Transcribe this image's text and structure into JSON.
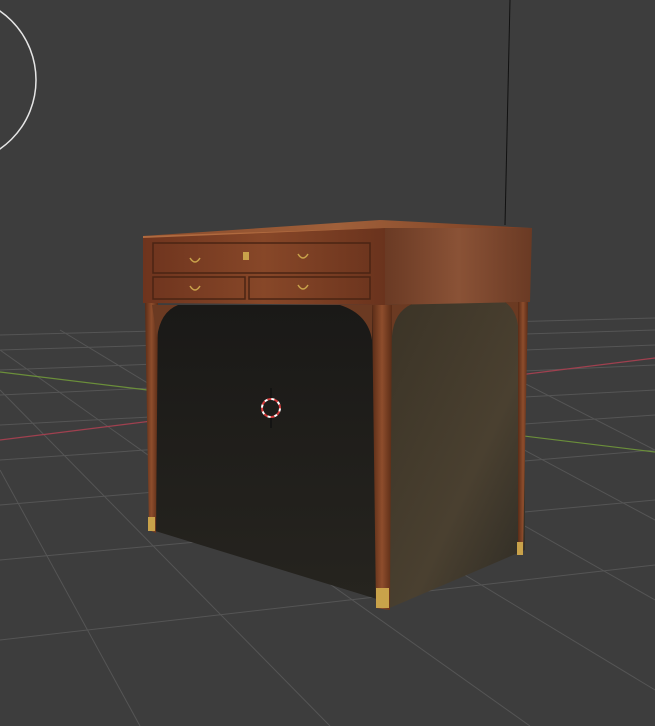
{
  "viewport": {
    "background_color": "#3d3d3d",
    "grid_color": "#555555",
    "x_axis_color": "#a0404f",
    "y_axis_color": "#6b8f3a"
  },
  "scene": {
    "object": "cabinet",
    "wood_color": "#7a3e23",
    "interior_color": "#1f1e1a",
    "brass_color": "#c9a24a"
  },
  "icons": {
    "cursor": "3d-cursor-icon",
    "light": "light-circle-icon"
  }
}
